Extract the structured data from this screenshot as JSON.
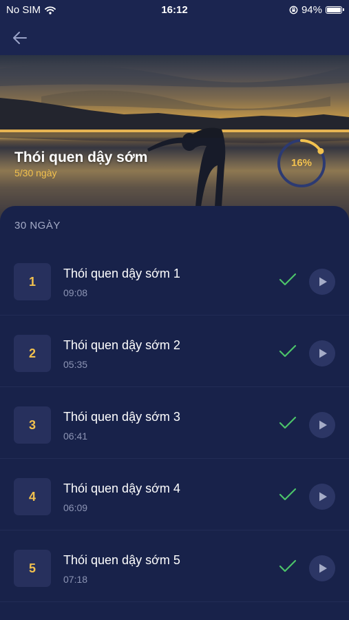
{
  "status_bar": {
    "carrier": "No SIM",
    "time": "16:12",
    "battery": "94%"
  },
  "hero": {
    "title": "Thói quen dậy sớm",
    "subtitle": "5/30 ngày",
    "progress_label": "16%",
    "progress_fraction": 0.16
  },
  "section": {
    "label": "30 NGÀY"
  },
  "lessons": [
    {
      "number": "1",
      "title": "Thói quen dậy sớm 1",
      "duration": "09:08",
      "completed": true
    },
    {
      "number": "2",
      "title": "Thói quen dậy sớm 2",
      "duration": "05:35",
      "completed": true
    },
    {
      "number": "3",
      "title": "Thói quen dậy sớm 3",
      "duration": "06:41",
      "completed": true
    },
    {
      "number": "4",
      "title": "Thói quen dậy sớm 4",
      "duration": "06:09",
      "completed": true
    },
    {
      "number": "5",
      "title": "Thói quen dậy sớm 5",
      "duration": "07:18",
      "completed": true
    }
  ],
  "colors": {
    "background": "#18224a",
    "accent": "#f2c14e",
    "check": "#4cc46a",
    "play_button": "#2c3665"
  }
}
